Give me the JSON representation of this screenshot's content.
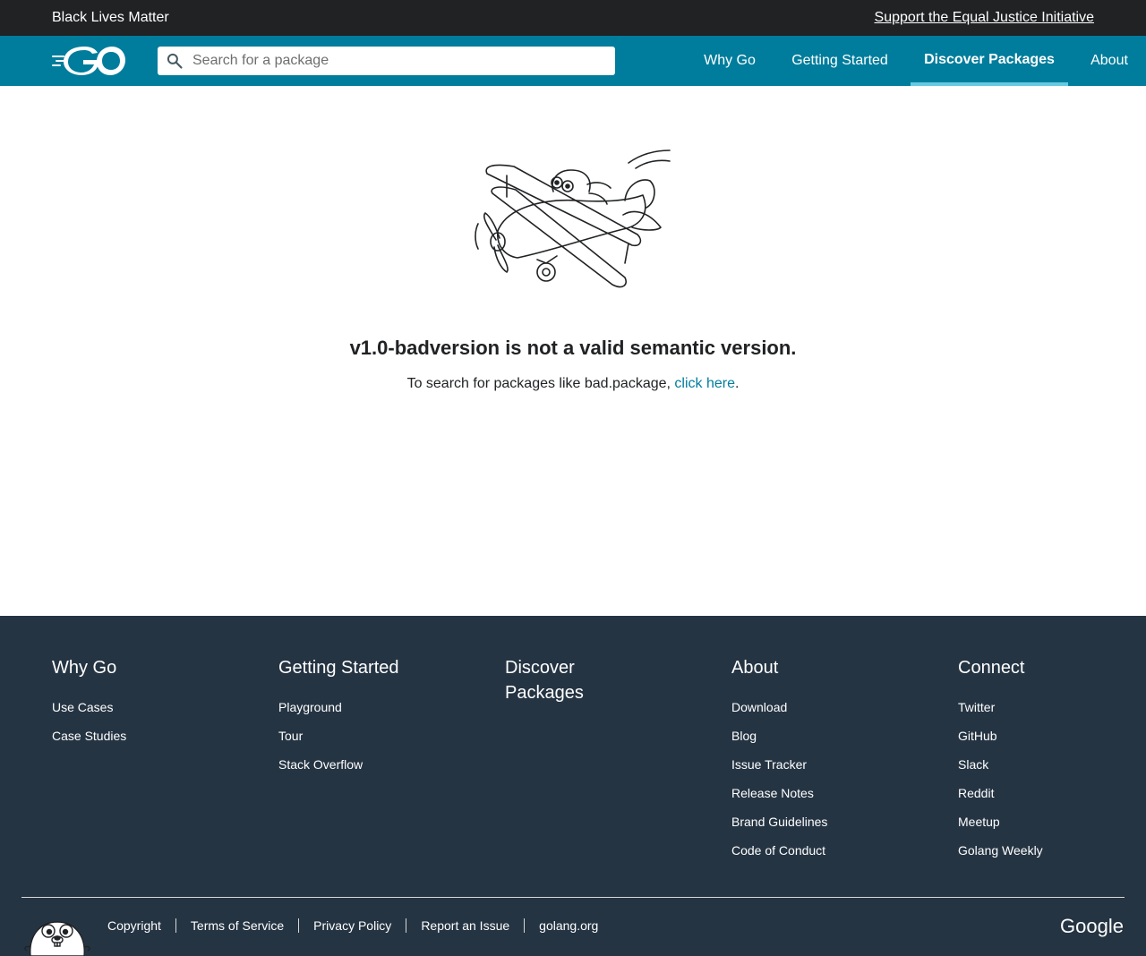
{
  "banner": {
    "left_text": "Black Lives Matter",
    "right_link": "Support the Equal Justice Initiative"
  },
  "header": {
    "logo_icon": "go-logo-icon",
    "search": {
      "placeholder": "Search for a package",
      "value": ""
    },
    "nav": [
      {
        "label": "Why Go",
        "active": false
      },
      {
        "label": "Getting Started",
        "active": false
      },
      {
        "label": "Discover Packages",
        "active": true
      },
      {
        "label": "About",
        "active": false
      }
    ]
  },
  "main": {
    "illustration_icon": "gopher-airplane-icon",
    "title": "v1.0-badversion is not a valid semantic version.",
    "message_prefix": "To search for packages like bad.package, ",
    "message_link": "click here",
    "message_suffix": "."
  },
  "footer": {
    "columns": [
      {
        "title": "Why Go",
        "links": [
          "Use Cases",
          "Case Studies"
        ]
      },
      {
        "title": "Getting Started",
        "links": [
          "Playground",
          "Tour",
          "Stack Overflow"
        ]
      },
      {
        "title": "Discover Packages",
        "links": []
      },
      {
        "title": "About",
        "links": [
          "Download",
          "Blog",
          "Issue Tracker",
          "Release Notes",
          "Brand Guidelines",
          "Code of Conduct"
        ]
      },
      {
        "title": "Connect",
        "links": [
          "Twitter",
          "GitHub",
          "Slack",
          "Reddit",
          "Meetup",
          "Golang Weekly"
        ]
      }
    ],
    "legal": [
      "Copyright",
      "Terms of Service",
      "Privacy Policy",
      "Report an Issue",
      "golang.org"
    ],
    "brand_logo": "Google"
  },
  "colors": {
    "banner_bg": "#202224",
    "header_bg": "#007d9c",
    "link": "#007d9c",
    "footer_bg": "#253443",
    "active_underline": "#66c9e0"
  }
}
